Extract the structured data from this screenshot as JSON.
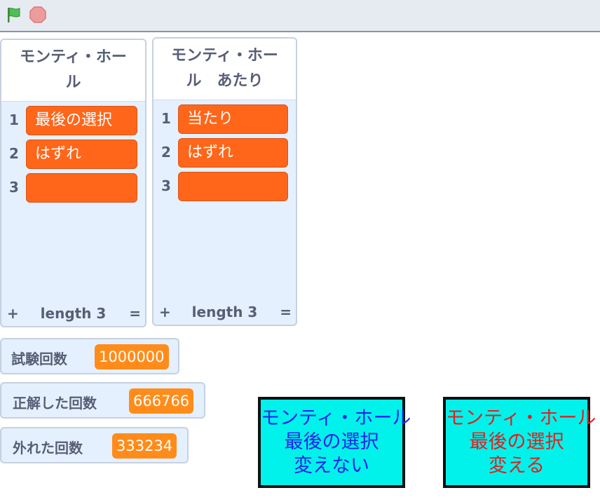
{
  "toolbar": {
    "green_flag_icon": "green-flag-icon",
    "stop_icon": "stop-sign-icon"
  },
  "lists": [
    {
      "title_line1": "モンティ・ホー",
      "title_line2": "ル",
      "items": [
        {
          "index": "1",
          "value": "最後の選択"
        },
        {
          "index": "2",
          "value": "はずれ"
        },
        {
          "index": "3",
          "value": ""
        }
      ],
      "footer": {
        "plus": "+",
        "length": "length 3",
        "eq": "="
      }
    },
    {
      "title_line1": "モンティ・ホー",
      "title_line2": "ル　あたり",
      "items": [
        {
          "index": "1",
          "value": "当たり"
        },
        {
          "index": "2",
          "value": "はずれ"
        },
        {
          "index": "3",
          "value": ""
        }
      ],
      "footer": {
        "plus": "+",
        "length": "length 3",
        "eq": "="
      }
    }
  ],
  "variables": [
    {
      "label": "試験回数",
      "value": "1000000"
    },
    {
      "label": "正解した回数",
      "value": "666766"
    },
    {
      "label": "外れた回数",
      "value": "333234"
    }
  ],
  "buttons": {
    "no_change": {
      "line1": "モンティ・ホール",
      "line2": "最後の選択",
      "line3": "変えない",
      "text_color": "#2222ee"
    },
    "change": {
      "line1": "モンティ・ホール",
      "line2": "最後の選択",
      "line3": "変える",
      "text_color": "#dd2222"
    }
  },
  "colors": {
    "list_item": "#ff661a",
    "variable_value": "#ff8c1a",
    "button_bg": "#00f2ea",
    "monitor_bg": "#e5f0ff"
  }
}
